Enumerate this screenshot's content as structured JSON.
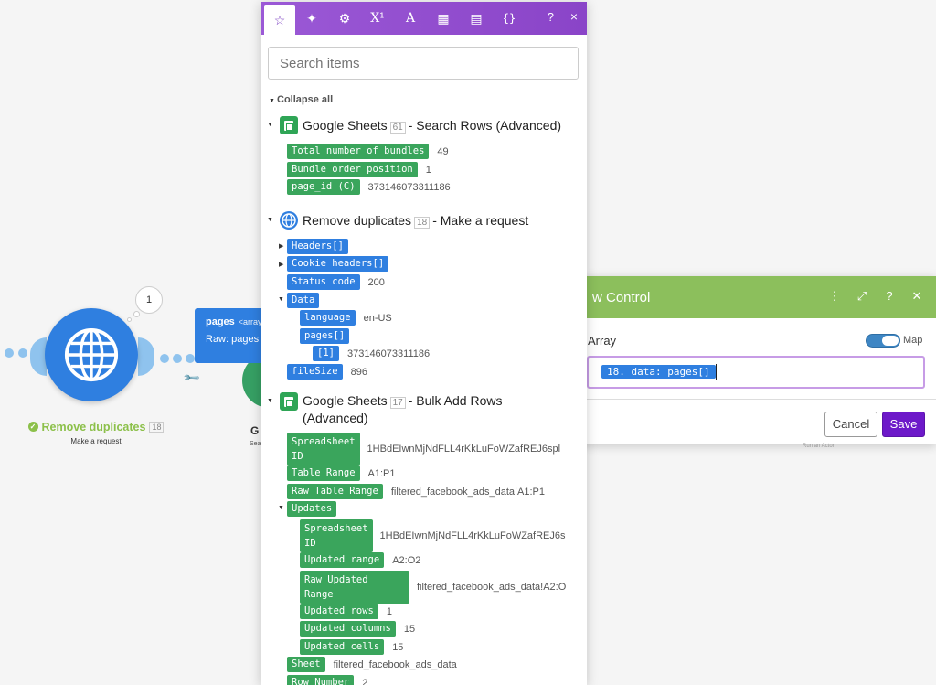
{
  "canvas": {
    "module1": {
      "name": "Remove duplicates",
      "number": "18",
      "subtitle": "Make a request",
      "bubble": "1"
    },
    "module2": {
      "name_partial": "G",
      "sub_partial": "Sea"
    }
  },
  "tooltip": {
    "name": "pages",
    "type": "<array>",
    "raw": "Raw: pages"
  },
  "dialog": {
    "title_partial": "w Control",
    "field_label": "Array",
    "map_label": "Map",
    "value_pill": "18. data: pages[]",
    "cancel": "Cancel",
    "save": "Save",
    "under_text": "Run an Actor"
  },
  "panel": {
    "search_placeholder": "Search items",
    "collapse_all": "Collapse all",
    "help": "?",
    "close": "×",
    "groups": [
      {
        "name": "Google Sheets",
        "number": "61",
        "action": "- Search Rows (Advanced)"
      },
      {
        "name": "Remove duplicates",
        "number": "18",
        "action": "- Make a request"
      },
      {
        "name": "Google Sheets",
        "number": "17",
        "action": "- Bulk Add Rows",
        "action2": "(Advanced)"
      }
    ],
    "items": {
      "total_bundles": {
        "label": "Total number of bundles",
        "value": "49"
      },
      "bundle_pos": {
        "label": "Bundle order position",
        "value": "1"
      },
      "page_id": {
        "label": "page_id (C)",
        "value": "373146073311186"
      },
      "headers": {
        "label": "Headers[]"
      },
      "cookie": {
        "label": "Cookie headers[]"
      },
      "status": {
        "label": "Status code",
        "value": "200"
      },
      "data": {
        "label": "Data"
      },
      "language": {
        "label": "language",
        "value": "en-US"
      },
      "pages": {
        "label": "pages[]"
      },
      "pages1": {
        "label": "[1]",
        "value": "373146073311186"
      },
      "filesize": {
        "label": "fileSize",
        "value": "896"
      },
      "spreadsheet_id": {
        "label1": "Spreadsheet",
        "label2": "ID",
        "value": "1HBdEIwnMjNdFLL4rKkLuFoWZafREJ6spl"
      },
      "table_range": {
        "label": "Table Range",
        "value": "A1:P1"
      },
      "raw_table_range": {
        "label": "Raw Table Range",
        "value": "filtered_facebook_ads_data!A1:P1"
      },
      "updates": {
        "label": "Updates"
      },
      "u_spreadsheet_id": {
        "label1": "Spreadsheet",
        "label2": "ID",
        "value": "1HBdEIwnMjNdFLL4rKkLuFoWZafREJ6s"
      },
      "updated_range": {
        "label": "Updated range",
        "value": "A2:O2"
      },
      "raw_updated_range": {
        "label1": "Raw Updated",
        "label2": "Range",
        "value": "filtered_facebook_ads_data!A2:O"
      },
      "updated_rows": {
        "label": "Updated rows",
        "value": "1"
      },
      "updated_columns": {
        "label": "Updated columns",
        "value": "15"
      },
      "updated_cells": {
        "label": "Updated cells",
        "value": "15"
      },
      "sheet": {
        "label": "Sheet",
        "value": "filtered_facebook_ads_data"
      },
      "row_number": {
        "label": "Row Number",
        "value": "2"
      }
    }
  }
}
